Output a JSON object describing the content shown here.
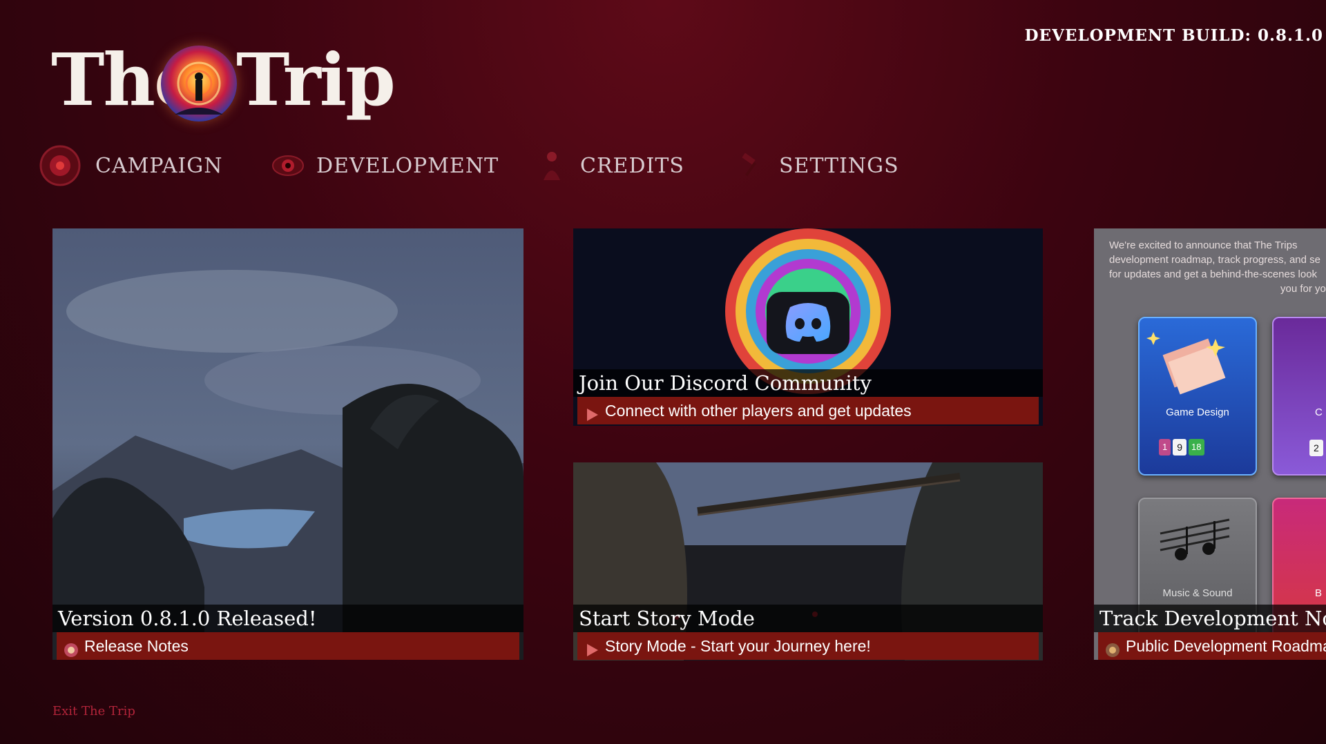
{
  "build": "DEVELOPMENT BUILD: 0.8.1.0",
  "logo": {
    "left_word": "The",
    "right_word": "Trip"
  },
  "nav": [
    {
      "label": "CAMPAIGN",
      "icon": "ornament-icon"
    },
    {
      "label": "DEVELOPMENT",
      "icon": "eye-icon"
    },
    {
      "label": "CREDITS",
      "icon": "figure-icon"
    },
    {
      "label": "SETTINGS",
      "icon": "hammer-icon"
    }
  ],
  "cards": {
    "release": {
      "title": "Version 0.8.1.0 Released!",
      "subtitle": "Release Notes"
    },
    "discord": {
      "title": "Join Our Discord Community",
      "subtitle": "Connect with other players and get updates"
    },
    "story": {
      "title": "Start Story Mode",
      "subtitle": "Story Mode - Start your Journey here!"
    },
    "roadmap": {
      "title": "Track Development Now",
      "subtitle": "Public Development Roadmap",
      "announcement": [
        "We're excited to announce that The Trips",
        "development roadmap, track progress, and se",
        "for updates and get a behind-the-scenes look",
        "you for yo"
      ],
      "tiles": [
        {
          "label": "Game Design",
          "counts": [
            "1",
            "9",
            "18"
          ]
        },
        {
          "label": "C",
          "counts": [
            "2"
          ]
        },
        {
          "label": "Music & Sound"
        },
        {
          "label": "B"
        }
      ]
    }
  },
  "exit": "Exit The Trip",
  "colors": {
    "accent_red": "#7a1510",
    "background": "#3c0410",
    "exit_red": "#b3243a"
  }
}
